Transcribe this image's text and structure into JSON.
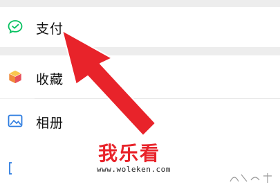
{
  "menu": {
    "items": [
      {
        "label": "支付",
        "icon": "wechat-pay-icon",
        "icon_color": "#07c160"
      },
      {
        "label": "收藏",
        "icon": "favorites-cube-icon",
        "icon_color": "#f5a623"
      },
      {
        "label": "相册",
        "icon": "album-icon",
        "icon_color": "#2b7be0"
      },
      {
        "label": "",
        "icon": "cards-icon",
        "icon_color": "#2b7be0"
      }
    ]
  },
  "watermark": {
    "brand": "我乐看",
    "url": "www.woleken.com"
  },
  "colors": {
    "background": "#ededed",
    "row": "#ffffff",
    "arrow": "#e8232a"
  }
}
